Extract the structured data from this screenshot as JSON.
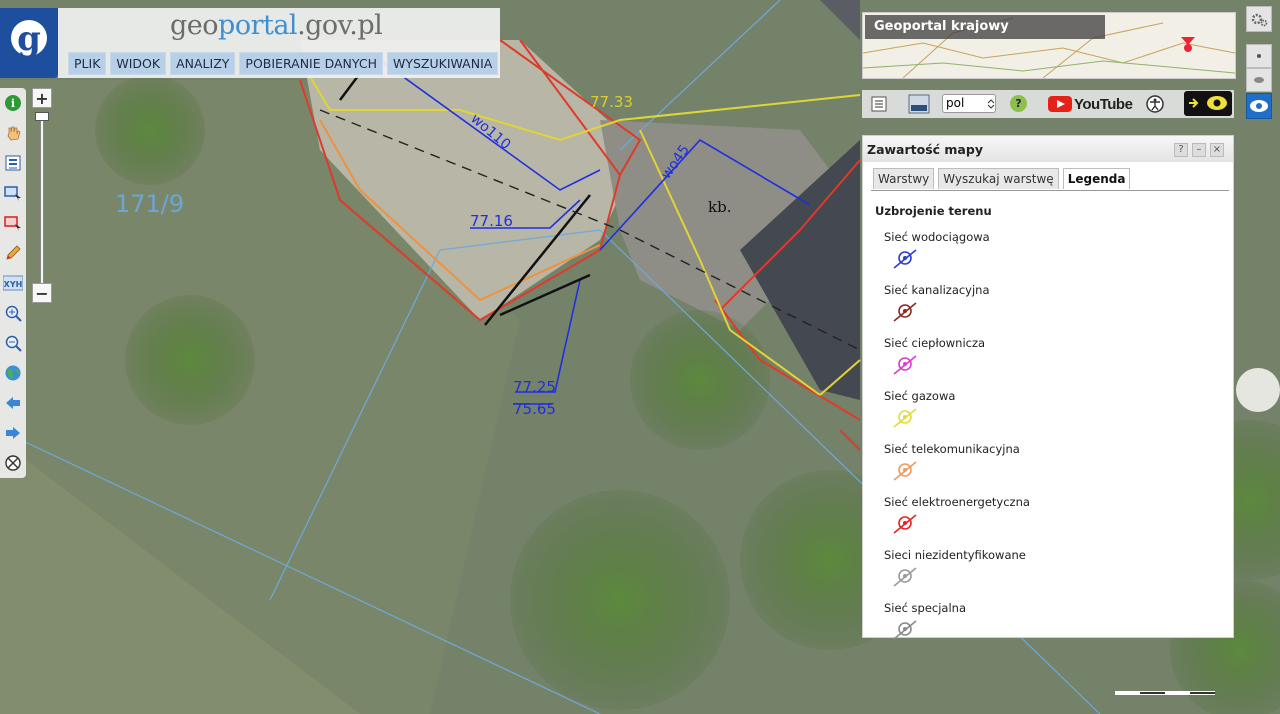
{
  "header": {
    "brand_part1": "geo",
    "brand_part2": "portal",
    "brand_part3": ".gov.pl",
    "menu": [
      "PLIK",
      "WIDOK",
      "ANALIZY",
      "POBIERANIE DANYCH",
      "WYSZUKIWANIA"
    ]
  },
  "zoom": {
    "plus": "+",
    "minus": "−"
  },
  "tools": [
    "info-icon",
    "pan-hand-icon",
    "layers-list-icon",
    "select-rect-icon",
    "select-red-icon",
    "pencil-icon",
    "xyh-icon",
    "zoom-in-icon",
    "zoom-out-icon",
    "globe-icon",
    "back-arrow-icon",
    "forward-arrow-icon",
    "reset-icon"
  ],
  "xyh_label": "XYH",
  "national": {
    "title": "Geoportal krajowy"
  },
  "toprow": {
    "language": "pol",
    "help": "?",
    "youtube": "YouTube"
  },
  "panel": {
    "title": "Zawartość mapy",
    "tabs": [
      "Warstwy",
      "Wyszukaj warstwę",
      "Legenda"
    ],
    "active_tab": "Legenda",
    "legend_title": "Uzbrojenie terenu",
    "legend": [
      {
        "label": "Sieć wodociągowa",
        "color": "#2a3ed6"
      },
      {
        "label": "Sieć kanalizacyjna",
        "color": "#8b2a1e"
      },
      {
        "label": "Sieć ciepłownicza",
        "color": "#d83cd1"
      },
      {
        "label": "Sieć gazowa",
        "color": "#e2dc3a"
      },
      {
        "label": "Sieć telekomunikacyjna",
        "color": "#f09a5a"
      },
      {
        "label": "Sieć elektroenergetyczna",
        "color": "#e22424"
      },
      {
        "label": "Sieci niezidentyfikowane",
        "color": "#9a9a9a"
      },
      {
        "label": "Sieć specjalna",
        "color": "#8a8a8a"
      }
    ]
  },
  "map_labels": {
    "parcel": "171/9",
    "elev1": "77.33",
    "elev2": "77.16",
    "elev3": "77.25",
    "elev4": "75.65",
    "building": "kb.",
    "wo1": "wo110",
    "wo2": "wo45"
  }
}
